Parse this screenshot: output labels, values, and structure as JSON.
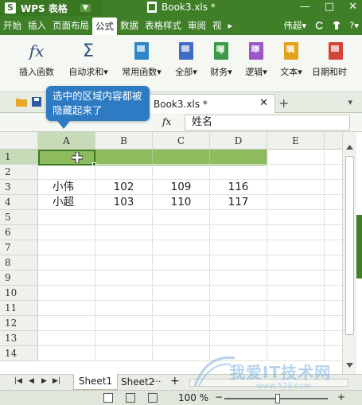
{
  "titlebar": {
    "app_logo": "S",
    "app_name": "WPS 表格",
    "app_dropdown": "▼",
    "doc_title": "Book3.xls *",
    "controls": [
      "—",
      "□",
      "✕"
    ]
  },
  "menubar": {
    "items": [
      "开始",
      "插入",
      "页面布局",
      "公式",
      "数据",
      "表格样式",
      "审阅",
      "视"
    ],
    "active": "公式",
    "more": "▸",
    "user": "伟超",
    "user_dd": "▾",
    "help": "?",
    "help_dd": "▾"
  },
  "ribbon": {
    "buttons": [
      {
        "label": "插入函数",
        "icon": "fx-icon"
      },
      {
        "label": "自动求和",
        "icon": "sigma-icon",
        "dd": "▾"
      },
      {
        "label": "常用函数",
        "icon": "common-func-icon",
        "dd": "▾"
      },
      {
        "label": "全部",
        "icon": "all-func-icon",
        "dd": "▾"
      },
      {
        "label": "财务",
        "icon": "finance-icon",
        "dd": "▾"
      },
      {
        "label": "逻辑",
        "icon": "logic-icon",
        "dd": "▾"
      },
      {
        "label": "文本",
        "icon": "text-icon",
        "dd": "▾"
      },
      {
        "label": "日期和时",
        "icon": "datetime-icon"
      }
    ],
    "fx_glyph": "fx",
    "sigma_glyph": "Σ",
    "finance_glyph": "$",
    "logic_glyph": "?",
    "text_glyph": "A",
    "colors": {
      "common": "#2f86c8",
      "all": "#3f6cc4",
      "finance": "#3a9a48",
      "logic": "#9a58c8",
      "text": "#e3a21a",
      "date": "#d64338"
    }
  },
  "workbook_tab": {
    "title": "Book3.xls *",
    "close": "✕",
    "add": "+",
    "menu": "▾"
  },
  "formula_bar": {
    "fx": "fx",
    "value": "姓名"
  },
  "tooltip": {
    "text": "选中的区域内容都被隐藏起来了"
  },
  "grid": {
    "columns": [
      "A",
      "B",
      "C",
      "D",
      "E"
    ],
    "rows": [
      "1",
      "2",
      "3",
      "4",
      "5",
      "6",
      "7",
      "8",
      "9",
      "10",
      "11",
      "12",
      "13",
      "14"
    ],
    "data": [
      [
        "小伟",
        "102",
        "109",
        "116"
      ],
      [
        "小超",
        "103",
        "110",
        "117"
      ]
    ],
    "selection_color": "#8dbb5e"
  },
  "sheets": {
    "tabs": [
      "Sheet1",
      "Sheet2"
    ],
    "active": "Sheet1",
    "more": "···",
    "add": "+",
    "nav": [
      "|◀",
      "◀",
      "▶",
      "▶|"
    ]
  },
  "statusbar": {
    "zoom": "100 %",
    "zoom_minus": "−",
    "zoom_plus": "+"
  },
  "watermark": {
    "text": "我爱IT技术网",
    "url": "www.52ij.com"
  }
}
